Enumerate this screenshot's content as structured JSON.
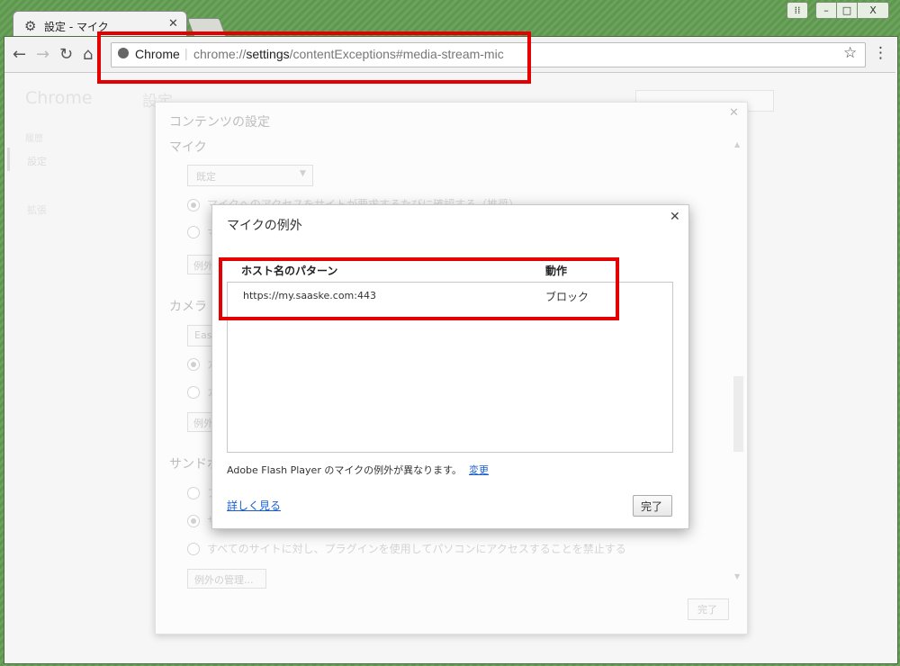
{
  "tab": {
    "title": "設定 - マイク"
  },
  "window_controls": {
    "minimize": "–",
    "maximize": "□",
    "close": "X"
  },
  "omnibox": {
    "chip": "Chrome",
    "separator": "|",
    "url_prefix": "chrome://",
    "url_host": "settings",
    "url_path": "/contentExceptions#media-stream-mic"
  },
  "background": {
    "sidebar_title": "Chrome",
    "sidebar_history": "履歴",
    "sidebar_settings": "設定",
    "sidebar_extensions": "拡張",
    "page_title": "設定"
  },
  "content_settings": {
    "title": "コンテンツの設定",
    "mic_heading": "マイク",
    "mic_select": "既定",
    "mic_radio_ask": "マイクへのアクセスをサイトが要求するたびに確認する（推奨）",
    "mic_radio_block": "マ",
    "manage_exceptions_short": "例外",
    "camera_heading": "カメラ",
    "camera_select": "Eas",
    "camera_radio_ask": "カ",
    "camera_radio_block": "カ",
    "sandbox_heading": "サンドボ",
    "sandbox_radio_1": "プ",
    "sandbox_radio_2": "サ",
    "sandbox_radio_deny": "すべてのサイトに対し、プラグインを使用してパソコンにアクセスすることを禁止する",
    "manage_exceptions": "例外の管理...",
    "done": "完了"
  },
  "mic_exceptions": {
    "title": "マイクの例外",
    "columns": {
      "host": "ホスト名のパターン",
      "action": "動作"
    },
    "rows": [
      {
        "host": "https://my.saaske.com:443",
        "action": "ブロック"
      }
    ],
    "flash_note": "Adobe Flash Player のマイクの例外が異なります。",
    "flash_link": "変更",
    "learn_more": "詳しく見る",
    "done": "完了"
  },
  "colors": {
    "highlight": "#e40000",
    "link": "#1a5fcf",
    "frame": "#5f9650"
  }
}
